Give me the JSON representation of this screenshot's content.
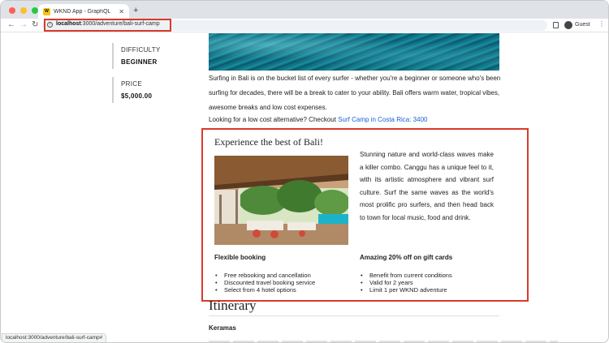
{
  "browser": {
    "tab_title": "WKND App - GraphQL",
    "favicon_text": "W",
    "url_host": "localhost",
    "url_rest": ":3000/adventure/bali-surf-camp",
    "profile_label": "Guest",
    "status_url": "localhost:3000/adventure/bali-surf-camp#"
  },
  "sidebar": {
    "difficulty_label": "DIFFICULTY",
    "difficulty_value": "BEGINNER",
    "price_label": "PRICE",
    "price_value": "$5,000.00"
  },
  "article": {
    "intro": "Surfing in Bali is on the bucket list of every surfer - whether you're a beginner or someone who's been surfing for decades, there will be a break to cater to your ability. Bali offers warm water, tropical vibes, awesome breaks and low cost expenses.",
    "alt_prefix": "Looking for a low cost alternative? Checkout ",
    "alt_link": "Surf Camp in Costa Rica: 3400"
  },
  "promo": {
    "title": "Experience the best of Bali!",
    "text": "Stunning nature and world-class waves make a killer combo. Canggu has a unique feel to it, with its artistic atmosphere and vibrant surf culture. Surf the same waves as the world's most prolific pro surfers, and then head back to town for local music, food and drink.",
    "booking_title": "Flexible booking",
    "booking_items": [
      "Free rebooking and cancellation",
      "Discounted travel booking service",
      "Select from 4 hotel options"
    ],
    "gift_title": "Amazing 20% off on gift cards",
    "gift_items": [
      "Benefit from current conditions",
      "Valid for 2 years",
      "Limit 1 per WKND adventure"
    ]
  },
  "itinerary": {
    "heading": "Itinerary",
    "day_title": "Keramas"
  },
  "colors": {
    "highlight": "#d93a2b",
    "link": "#1a5fd6"
  }
}
